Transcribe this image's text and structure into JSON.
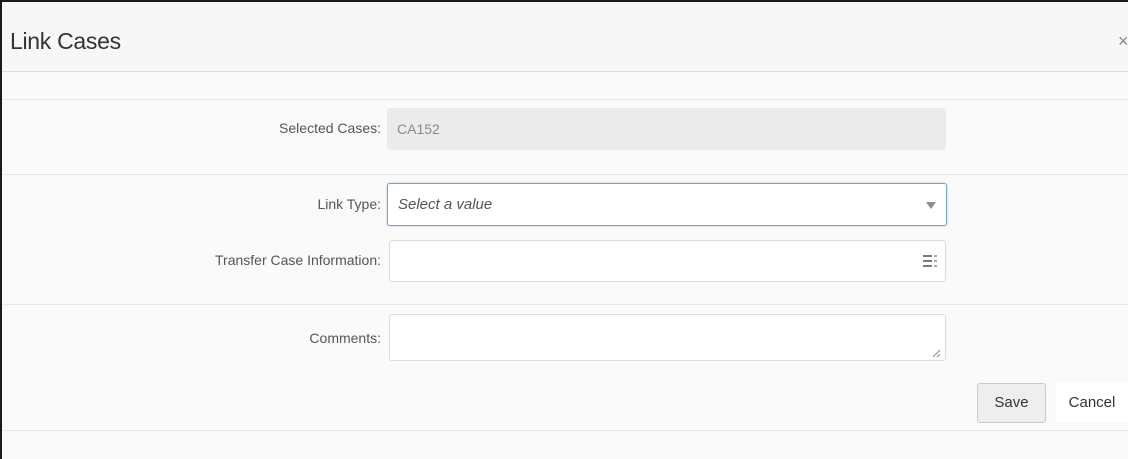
{
  "dialog": {
    "title": "Link Cases",
    "close_glyph": "×"
  },
  "form": {
    "selected_cases": {
      "label": "Selected Cases:",
      "value": "CA152"
    },
    "link_type": {
      "label": "Link Type:",
      "placeholder": "Select a value"
    },
    "transfer_case_information": {
      "label": "Transfer Case Information:",
      "value": ""
    },
    "comments": {
      "label": "Comments:",
      "value": ""
    }
  },
  "actions": {
    "save_label": "Save",
    "cancel_label": "Cancel"
  },
  "icons": {
    "close": "close-icon",
    "dropdown": "chevron-down-icon",
    "list_of_values": "list-icon"
  },
  "colors": {
    "focus_border": "#6fa3d6",
    "readonly_bg": "#ebebeb"
  }
}
